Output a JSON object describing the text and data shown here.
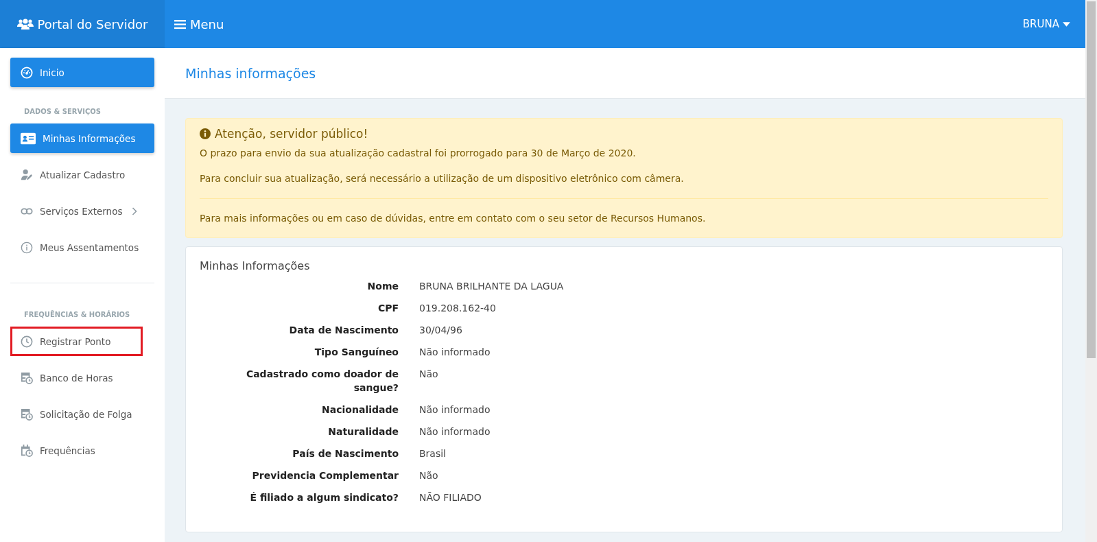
{
  "brand": {
    "title": "Portal do Servidor"
  },
  "topbar": {
    "menu_label": "Menu",
    "user": "BRUNA"
  },
  "sidebar": {
    "sections": [
      {
        "items": [
          {
            "label": "Inicio",
            "selected": true,
            "highlighted": false,
            "has_submenu": false
          }
        ]
      },
      {
        "heading": "DADOS & SERVIÇOS",
        "items": [
          {
            "label": "Minhas Informações",
            "selected": true,
            "highlighted": false,
            "has_submenu": false
          },
          {
            "label": "Atualizar Cadastro",
            "selected": false,
            "highlighted": false,
            "has_submenu": false
          },
          {
            "label": "Serviços Externos",
            "selected": false,
            "highlighted": false,
            "has_submenu": true
          },
          {
            "label": "Meus Assentamentos",
            "selected": false,
            "highlighted": false,
            "has_submenu": false
          }
        ]
      },
      {
        "heading": "FREQUÊNCIAS & HORÁRIOS",
        "items": [
          {
            "label": "Registrar Ponto",
            "selected": false,
            "highlighted": true,
            "has_submenu": false
          },
          {
            "label": "Banco de Horas",
            "selected": false,
            "highlighted": false,
            "has_submenu": false
          },
          {
            "label": "Solicitação de Folga",
            "selected": false,
            "highlighted": false,
            "has_submenu": false
          },
          {
            "label": "Frequências",
            "selected": false,
            "highlighted": false,
            "has_submenu": false
          }
        ]
      }
    ]
  },
  "page": {
    "title": "Minhas informações"
  },
  "alert": {
    "title": "Atenção, servidor público!",
    "paragraphs": [
      "O prazo para envio da sua atualização cadastral foi prorrogado para 30 de Março de 2020.",
      "Para concluir sua atualização, será necessário a utilização de um dispositivo eletrônico com câmera."
    ],
    "footer": "Para mais informações ou em caso de dúvidas, entre em contato com o seu setor de Recursos Humanos."
  },
  "info_card": {
    "title": "Minhas Informações",
    "fields": [
      {
        "label": "Nome",
        "value": "BRUNA BRILHANTE DA LAGUA"
      },
      {
        "label": "CPF",
        "value": "019.208.162-40"
      },
      {
        "label": "Data de Nascimento",
        "value": "30/04/96"
      },
      {
        "label": "Tipo Sanguíneo",
        "value": "Não informado"
      },
      {
        "label": "Cadastrado como doador de sangue?",
        "value": "Não"
      },
      {
        "label": "Nacionalidade",
        "value": "Não informado"
      },
      {
        "label": "Naturalidade",
        "value": "Não informado"
      },
      {
        "label": "País de Nascimento",
        "value": "Brasil"
      },
      {
        "label": "Previdencia Complementar",
        "value": "Não"
      },
      {
        "label": "É filiado a algum sindicato?",
        "value": "NÃO FILIADO"
      }
    ]
  }
}
